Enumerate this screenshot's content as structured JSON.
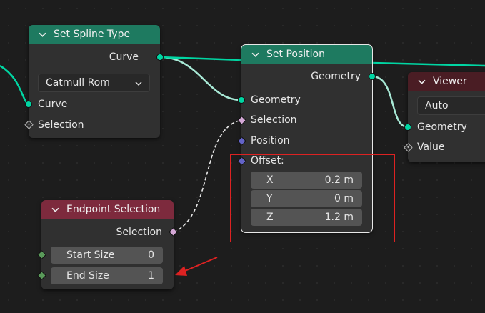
{
  "nodes": {
    "set_spline_type": {
      "title": "Set Spline Type",
      "output_curve": "Curve",
      "spline_type": "Catmull Rom",
      "input_curve": "Curve",
      "input_selection": "Selection"
    },
    "set_position": {
      "title": "Set Position",
      "output_geometry": "Geometry",
      "input_geometry": "Geometry",
      "input_selection": "Selection",
      "input_position": "Position",
      "input_offset": "Offset:",
      "offset": [
        {
          "axis": "X",
          "value": "0.2 m"
        },
        {
          "axis": "Y",
          "value": "0 m"
        },
        {
          "axis": "Z",
          "value": "1.2 m"
        }
      ]
    },
    "viewer": {
      "title": "Viewer",
      "domain": "Auto",
      "input_geometry": "Geometry",
      "input_value": "Value"
    },
    "endpoint_selection": {
      "title": "Endpoint Selection",
      "output_selection": "Selection",
      "start_size_label": "Start Size",
      "start_size_value": "0",
      "end_size_label": "End Size",
      "end_size_value": "1"
    }
  },
  "colors": {
    "geometry_header": "#1e7a60",
    "input_header": "#7d2a3d",
    "geometry_socket": "#00d6a3",
    "boolean_socket": "#d4a8d6",
    "vector_socket": "#6363c7",
    "annotation": "#dd2222"
  },
  "icons": [
    "chevron-down-icon",
    "dropdown-arrow-icon",
    "red-arrow-annotation"
  ]
}
